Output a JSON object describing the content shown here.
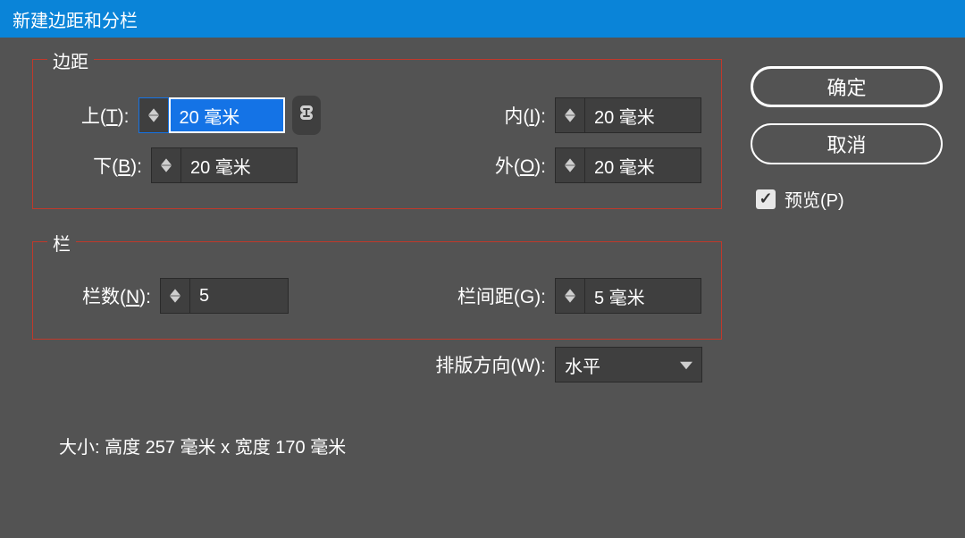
{
  "title": "新建边距和分栏",
  "buttons": {
    "ok": "确定",
    "cancel": "取消",
    "preview": "预览(P)"
  },
  "margins": {
    "legend": "边距",
    "top": {
      "label_prefix": "上(",
      "label_u": "T",
      "label_suffix": "):",
      "value": "20 毫米"
    },
    "bottom": {
      "label_prefix": "下(",
      "label_u": "B",
      "label_suffix": "):",
      "value": "20 毫米"
    },
    "inside": {
      "label_prefix": "内(",
      "label_u": "I",
      "label_suffix": "):",
      "value": "20 毫米"
    },
    "outside": {
      "label_prefix": "外(",
      "label_u": "O",
      "label_suffix": "):",
      "value": "20 毫米"
    }
  },
  "columns": {
    "legend": "栏",
    "count": {
      "label_prefix": "栏数(",
      "label_u": "N",
      "label_suffix": "):",
      "value": "5"
    },
    "gutter": {
      "label_prefix": "栏间距(",
      "label_u": "G",
      "label_suffix": "):",
      "value": "5 毫米"
    },
    "direction": {
      "label_prefix": "排版方向(",
      "label_u": "W",
      "label_suffix": "):",
      "value": "水平"
    }
  },
  "size_line": "大小: 高度 257 毫米 x 宽度 170 毫米"
}
